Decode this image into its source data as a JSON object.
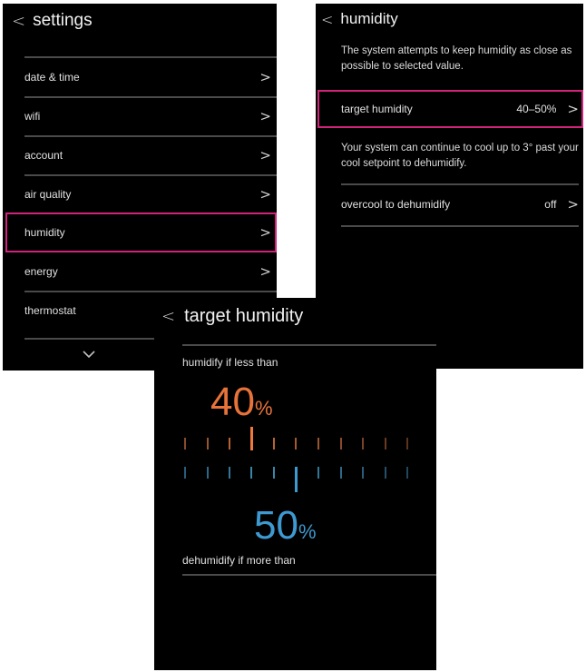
{
  "settings": {
    "title": "settings",
    "items": [
      {
        "label": "date & time"
      },
      {
        "label": "wifi"
      },
      {
        "label": "account"
      },
      {
        "label": "air quality"
      },
      {
        "label": "humidity"
      },
      {
        "label": "energy"
      },
      {
        "label": "thermostat"
      }
    ]
  },
  "humidity": {
    "title": "humidity",
    "description": "The system attempts to keep humidity as close as possible to selected value.",
    "target_row": {
      "label": "target humidity",
      "value": "40–50%"
    },
    "note": "Your system can continue to cool up to 3° past your cool setpoint to dehumidify.",
    "overcool_row": {
      "label": "overcool to dehumidify",
      "value": "off"
    }
  },
  "target": {
    "title": "target humidity",
    "humidify_label": "humidify if less than",
    "humidify_value": "40",
    "dehumidify_value": "50",
    "percent_sign": "%",
    "dehumidify_label": "dehumidify if more than"
  },
  "icons": {
    "back": "back-chevron-icon",
    "chevron": "chevron-right-icon",
    "scroll_down": "chevron-down-icon"
  },
  "colors": {
    "highlight": "#d0237a",
    "humidify": "#e8733a",
    "dehumidify": "#3d9ad1",
    "background": "#000000"
  }
}
